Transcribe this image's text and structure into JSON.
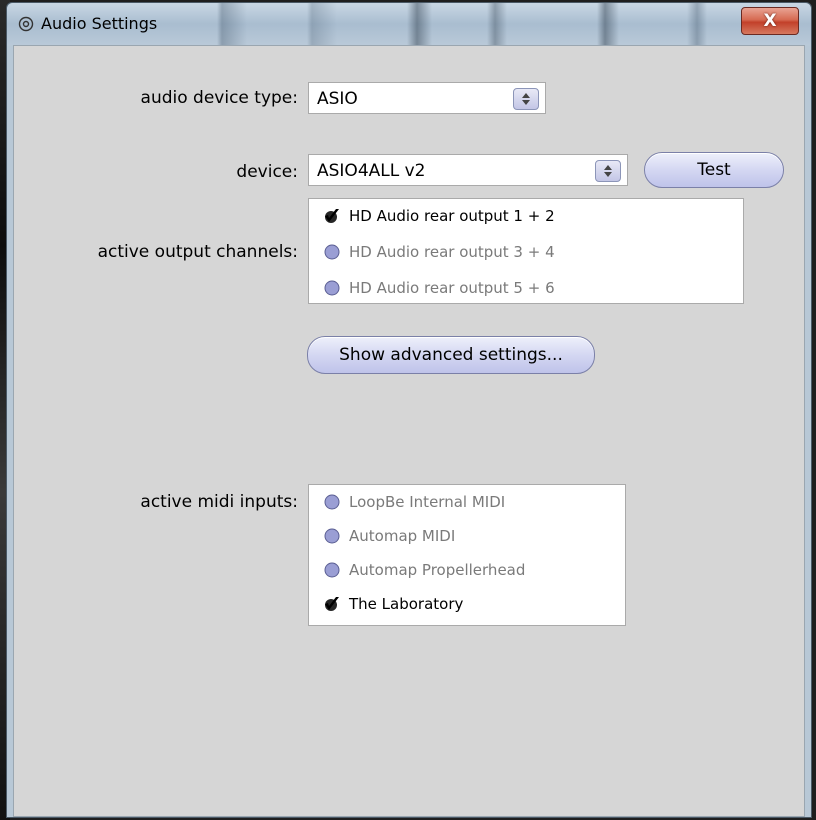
{
  "window": {
    "title": "Audio Settings",
    "close_label": "X"
  },
  "audio_device_type": {
    "label": "audio device type:",
    "value": "ASIO"
  },
  "device": {
    "label": "device:",
    "value": "ASIO4ALL v2",
    "test_label": "Test"
  },
  "output_channels": {
    "label": "active output channels:",
    "items": [
      {
        "label": "HD Audio rear output 1 + 2",
        "checked": true
      },
      {
        "label": "HD Audio rear output 3 + 4",
        "checked": false
      },
      {
        "label": "HD Audio rear output 5 + 6",
        "checked": false
      }
    ]
  },
  "advanced_button_label": "Show advanced settings...",
  "midi_inputs": {
    "label": "active midi inputs:",
    "items": [
      {
        "label": "LoopBe Internal MIDI",
        "checked": false
      },
      {
        "label": "Automap MIDI",
        "checked": false
      },
      {
        "label": "Automap Propellerhead",
        "checked": false
      },
      {
        "label": "The Laboratory",
        "checked": true
      }
    ]
  },
  "colors": {
    "toggle_off": "#9a9ed4",
    "toggle_on": "#000000",
    "panel": "#d6d6d6"
  }
}
